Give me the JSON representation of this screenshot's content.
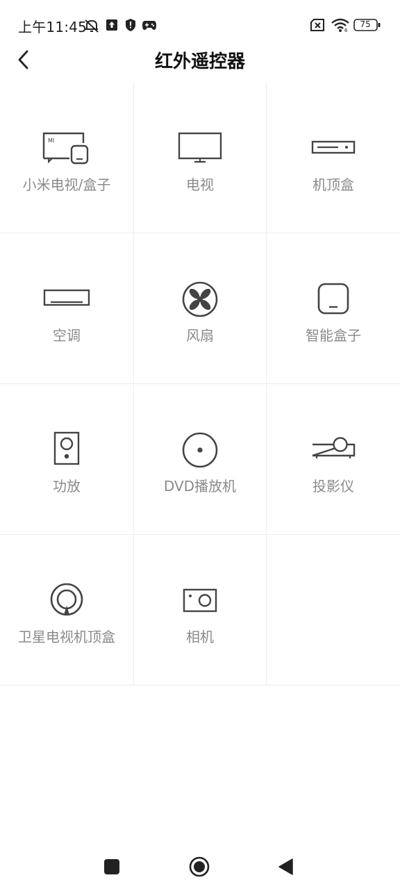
{
  "status_bar": {
    "time": "上午11:45",
    "battery_level": "75",
    "icons": [
      "mute-bell-icon",
      "upload-icon",
      "shield-icon",
      "gamepad-icon",
      "sim-disabled-icon",
      "wifi-icon",
      "battery-icon"
    ]
  },
  "header": {
    "title": "红外遥控器",
    "back_icon": "chevron-left-icon"
  },
  "devices": [
    {
      "label": "小米电视/盒子",
      "icon": "mi-tv-box-icon"
    },
    {
      "label": "电视",
      "icon": "tv-icon"
    },
    {
      "label": "机顶盒",
      "icon": "set-top-box-icon"
    },
    {
      "label": "空调",
      "icon": "air-conditioner-icon"
    },
    {
      "label": "风扇",
      "icon": "fan-icon"
    },
    {
      "label": "智能盒子",
      "icon": "smart-box-icon"
    },
    {
      "label": "功放",
      "icon": "amplifier-icon"
    },
    {
      "label": "DVD播放机",
      "icon": "dvd-player-icon"
    },
    {
      "label": "投影仪",
      "icon": "projector-icon"
    },
    {
      "label": "卫星电视机顶盒",
      "icon": "satellite-box-icon"
    },
    {
      "label": "相机",
      "icon": "camera-icon"
    }
  ],
  "nav_bar": {
    "buttons": [
      "recents-square-icon",
      "home-circle-icon",
      "back-triangle-icon"
    ]
  },
  "colors": {
    "icon_stroke": "#444444",
    "label": "#8a8a8a",
    "divider": "#ececec"
  }
}
